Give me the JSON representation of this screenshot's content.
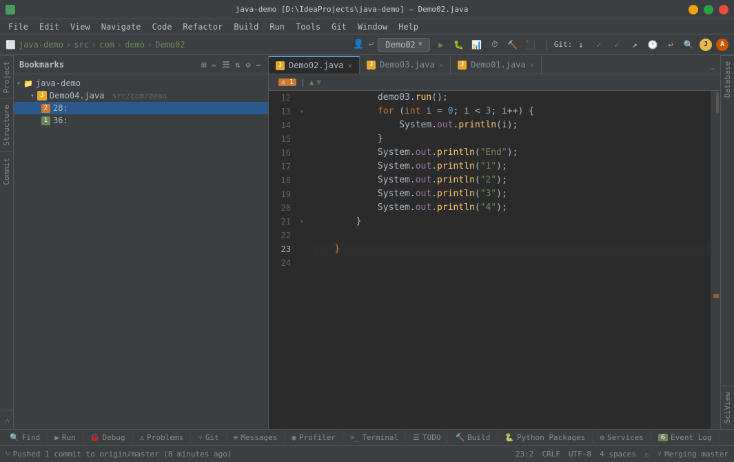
{
  "titlebar": {
    "title": "java-demo [D:\\IdeaProjects\\java-demo] – Demo02.java",
    "menu_items": [
      "File",
      "Edit",
      "View",
      "Navigate",
      "Code",
      "Refactor",
      "Build",
      "Run",
      "Tools",
      "Git",
      "Window",
      "Help"
    ]
  },
  "navbar": {
    "run_config": "Demo02",
    "breadcrumbs": [
      "java-demo",
      "src",
      "com",
      "demo",
      "Demo02"
    ]
  },
  "bookmarks_panel": {
    "title": "Bookmarks",
    "items": [
      {
        "id": "root",
        "label": "java-demo",
        "type": "project",
        "indent": 0,
        "expanded": true
      },
      {
        "id": "demo04",
        "label": "Demo04.java",
        "path": "src/com/demo",
        "type": "java",
        "indent": 2,
        "expanded": true
      },
      {
        "id": "bm28",
        "label": "28:",
        "badge": "2",
        "indent": 4
      },
      {
        "id": "bm36",
        "label": "36:",
        "badge": "1",
        "indent": 4
      }
    ]
  },
  "editor_tabs": [
    {
      "label": "Demo02.java",
      "active": true,
      "modified": false
    },
    {
      "label": "Demo03.java",
      "active": false,
      "modified": false
    },
    {
      "label": "Demo01.java",
      "active": false,
      "modified": false
    }
  ],
  "breadcrumb": {
    "warning_count": "1",
    "items": []
  },
  "code": {
    "lines": [
      {
        "num": "12",
        "content": "            demo03.run();"
      },
      {
        "num": "13",
        "content": "            for (int i = 0; i < 3; i++) {",
        "has_fold": true
      },
      {
        "num": "14",
        "content": "                System.out.println(i);"
      },
      {
        "num": "15",
        "content": "            }",
        "has_fold_end": true
      },
      {
        "num": "16",
        "content": "            System.out.println(\"End\");"
      },
      {
        "num": "17",
        "content": "            System.out.println(\"1\");"
      },
      {
        "num": "18",
        "content": "            System.out.println(\"2\");"
      },
      {
        "num": "19",
        "content": "            System.out.println(\"3\");"
      },
      {
        "num": "20",
        "content": "            System.out.println(\"4\");"
      },
      {
        "num": "21",
        "content": "        }",
        "has_fold_end": true
      },
      {
        "num": "22",
        "content": ""
      },
      {
        "num": "23",
        "content": "    }",
        "is_current": true
      },
      {
        "num": "24",
        "content": ""
      }
    ]
  },
  "right_vtabs": [
    "Database",
    "SciView"
  ],
  "left_vtabs": [
    "Project",
    "Structure",
    "Commit",
    "Git"
  ],
  "statusbar": {
    "position": "23:2",
    "line_ending": "CRLF",
    "encoding": "UTF-8",
    "indent": "4 spaces",
    "warning": "⚠",
    "branch": "Merging master",
    "git_icon": "⑂",
    "pushed_msg": "Pushed 1 commit to origin/master (8 minutes ago)"
  },
  "bottom_tabs": [
    {
      "label": "Find",
      "icon": "🔍",
      "num": null
    },
    {
      "label": "Run",
      "icon": "▶",
      "num": null
    },
    {
      "label": "Debug",
      "icon": "🐛",
      "num": null
    },
    {
      "label": "Problems",
      "icon": "⚠",
      "num": null
    },
    {
      "label": "Git",
      "icon": "⑂",
      "num": null
    },
    {
      "label": "Messages",
      "icon": "≡",
      "num": null
    },
    {
      "label": "Profiler",
      "icon": "◉",
      "num": null
    },
    {
      "label": "Terminal",
      "icon": ">_",
      "num": null
    },
    {
      "label": "TODO",
      "icon": "☰",
      "num": null
    },
    {
      "label": "Build",
      "icon": "🔨",
      "num": null
    },
    {
      "label": "Python Packages",
      "icon": "🐍",
      "num": null
    },
    {
      "label": "Services",
      "icon": "⚙",
      "num": null
    },
    {
      "label": "Event Log",
      "icon": "📋",
      "event_num": "6",
      "num": null
    }
  ]
}
